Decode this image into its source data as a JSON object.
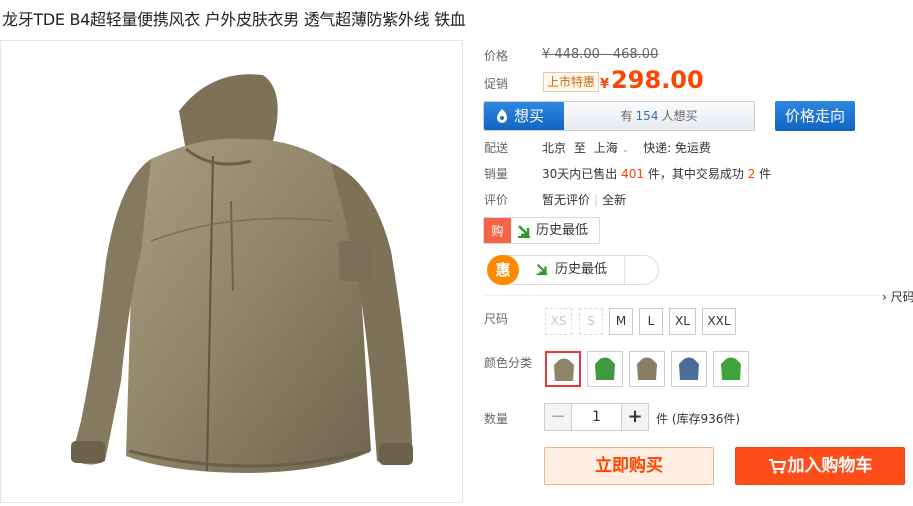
{
  "product": {
    "title": "龙牙TDE B4超轻量便携风衣 户外皮肤衣男 透气超薄防紫外线 铁血"
  },
  "price": {
    "label": "价格",
    "original": "¥ 448.00 - 468.00"
  },
  "promo": {
    "label": "促销",
    "tag": "上市特惠",
    "currency": "¥",
    "price": "298.00"
  },
  "want": {
    "button_label": "想买",
    "prefix": "有",
    "count": "154",
    "suffix": "人想买"
  },
  "price_trend_label": "价格走向",
  "shipping": {
    "label": "配送",
    "from": "北京",
    "to_word": "至",
    "to": "上海",
    "method": "快递: 免运费"
  },
  "sales": {
    "label": "销量",
    "prefix": "30天内已售出",
    "sold": "401",
    "middle": "件，其中交易成功",
    "success": "2",
    "suffix": "件"
  },
  "reviews": {
    "label": "评价",
    "none": "暂无评价",
    "all": "全新"
  },
  "history": {
    "gou": "购",
    "label1": "历史最低",
    "hui": "惠",
    "label2": "历史最低"
  },
  "size_chart_link": "› 尺码",
  "sizes": {
    "label": "尺码",
    "options": [
      "XS",
      "S",
      "M",
      "L",
      "XL",
      "XXL"
    ]
  },
  "colors": {
    "label": "颜色分类",
    "swatches": [
      "#8f8468",
      "#3f9a3f",
      "#8a7d66",
      "#4c6d98",
      "#3fa23c"
    ]
  },
  "quantity": {
    "label": "数量",
    "minus": "−",
    "value": "1",
    "plus": "+",
    "stock": "件 (库存936件)"
  },
  "actions": {
    "buy_now": "立即购买",
    "add_to_cart": "加入购物车"
  },
  "theme": {
    "accent": "#ff4400",
    "blue": "#1a73d0",
    "product_color": "#8f8468"
  }
}
